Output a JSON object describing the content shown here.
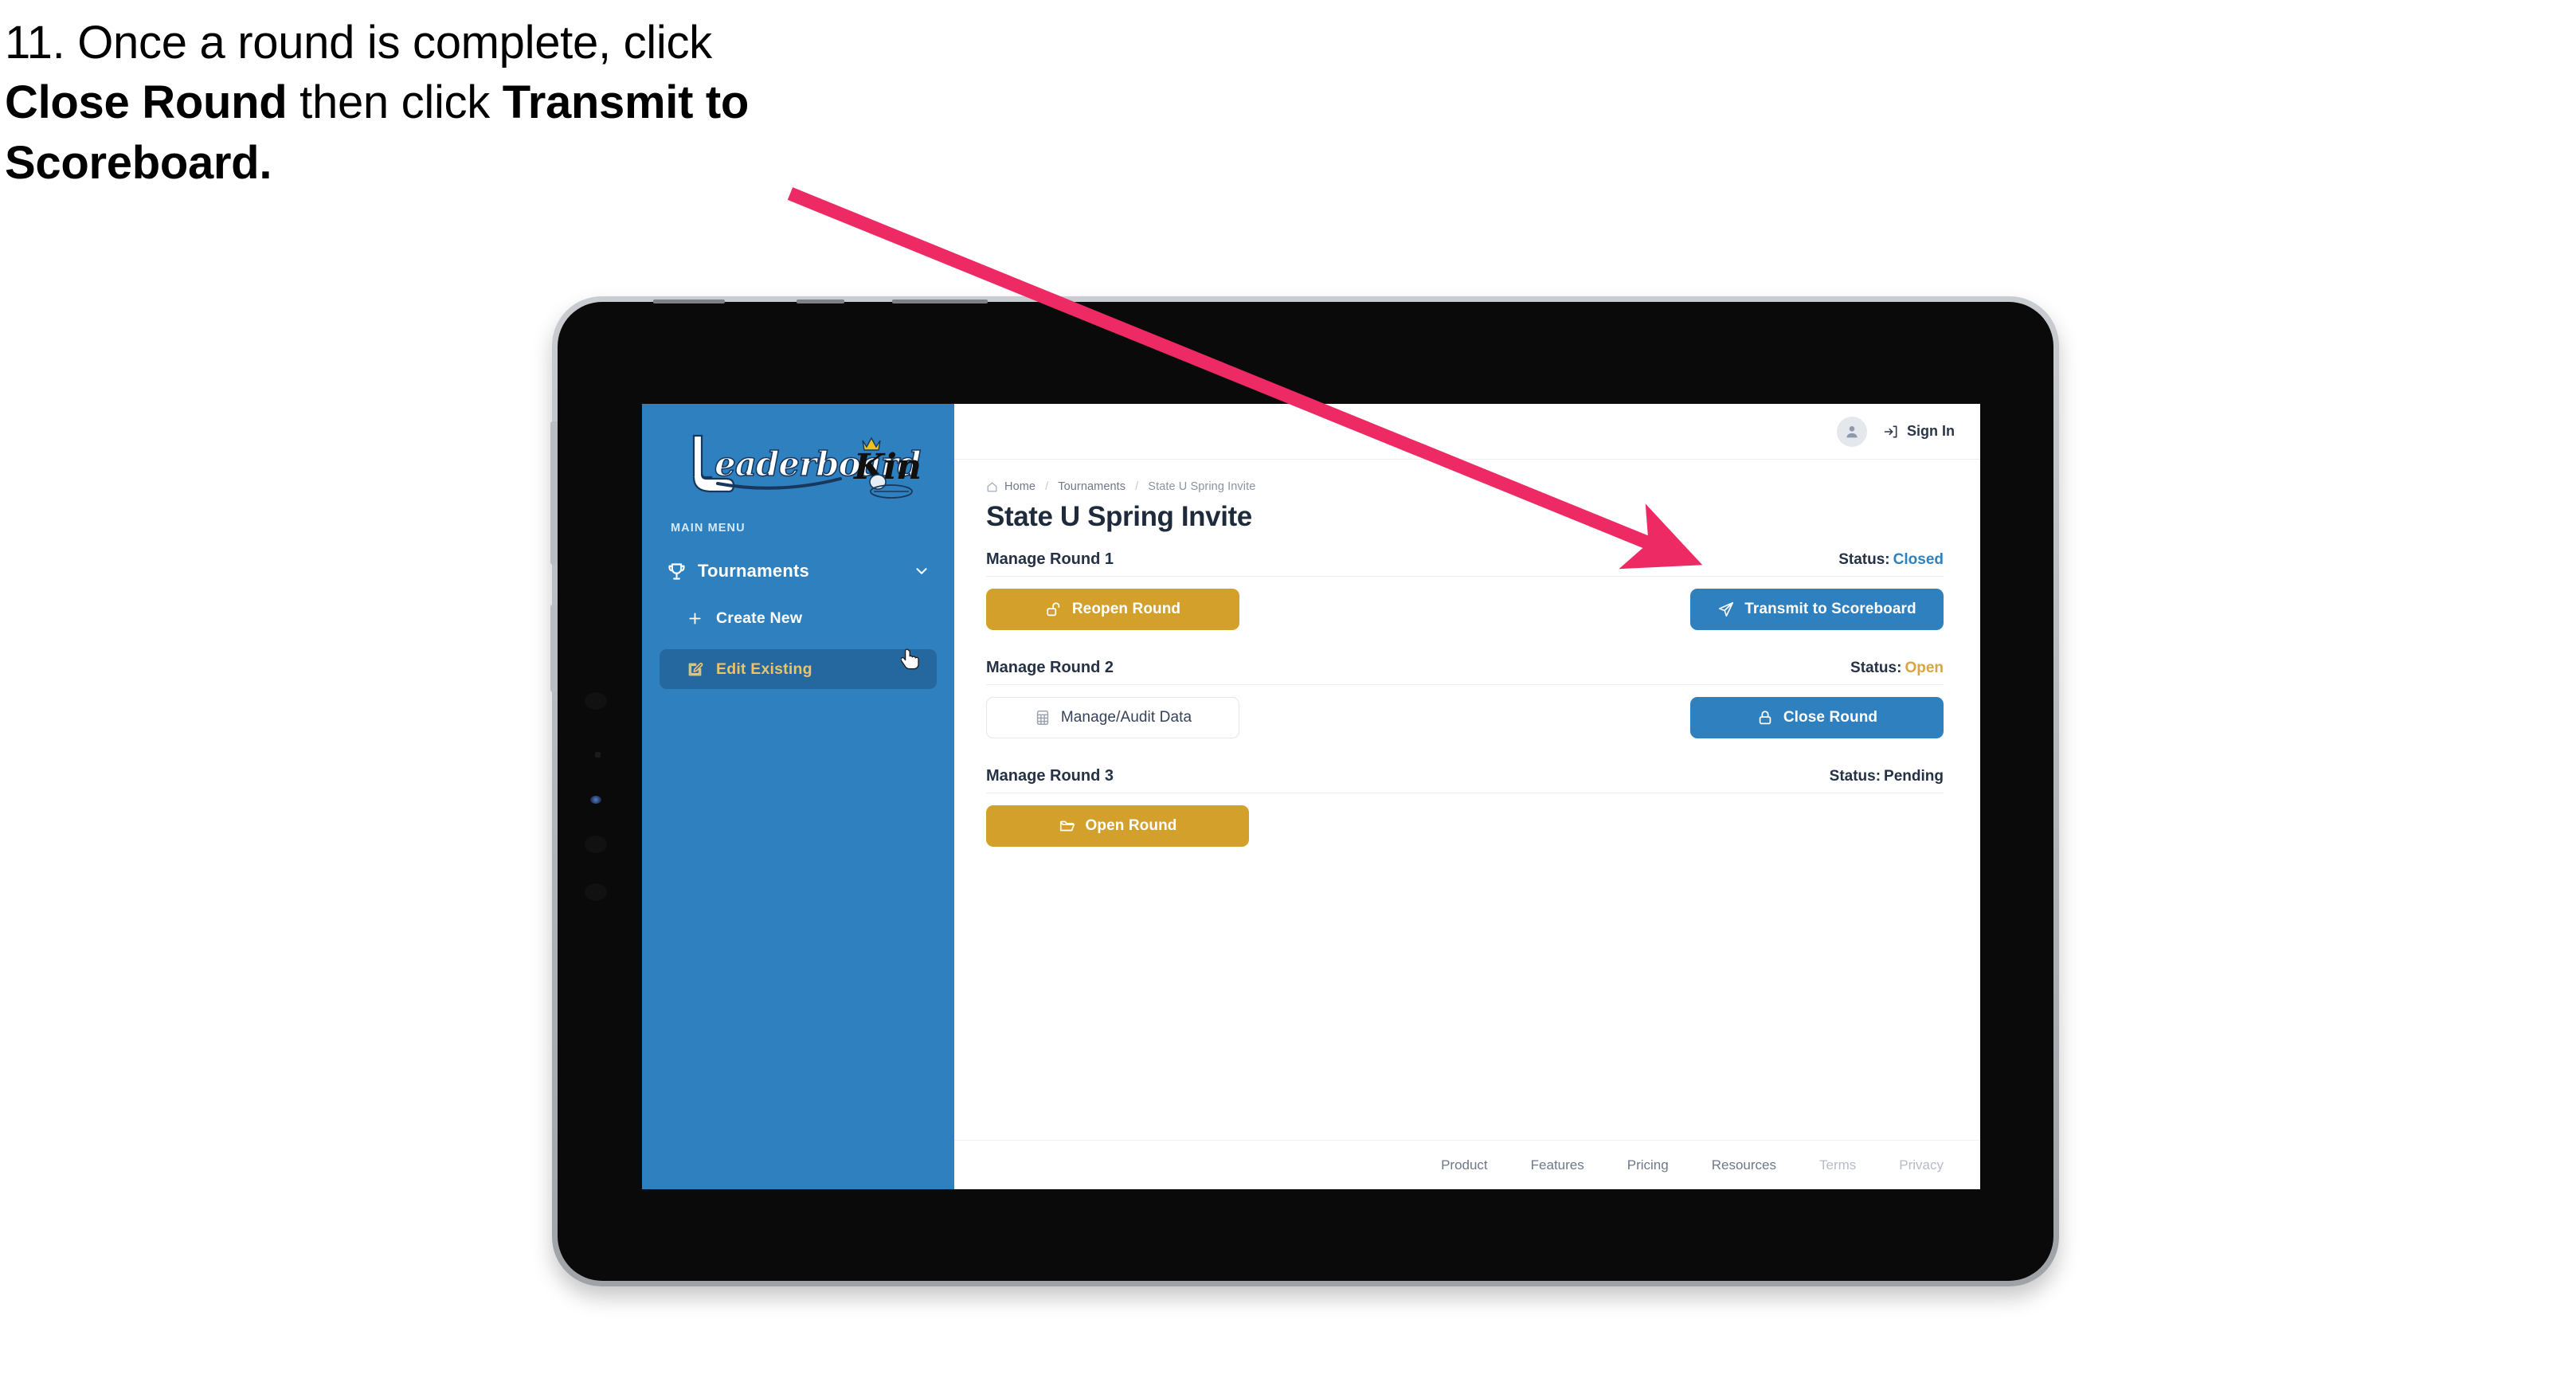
{
  "annotation": {
    "step_number": "11.",
    "text_part1": "11. Once a round is complete, click ",
    "bold1": "Close Round",
    "text_part2": " then click ",
    "bold2": "Transmit to Scoreboard.",
    "arrow_color": "#ed2a63"
  },
  "app": {
    "brand": {
      "word1": "Leaderboard",
      "word2": "King",
      "sidebar_color": "#2f80bf",
      "accent_gold": "#d4a02c",
      "accent_blue": "#2f80bf"
    },
    "sidebar": {
      "section_label": "MAIN MENU",
      "group": {
        "label": "Tournaments",
        "icon": "trophy-icon",
        "chevron": "chevron-down-icon",
        "expanded": true
      },
      "items": [
        {
          "label": "Create New",
          "icon": "plus-icon",
          "active": false
        },
        {
          "label": "Edit Existing",
          "icon": "pencil-square-icon",
          "active": true
        }
      ]
    },
    "topbar": {
      "avatar_icon": "user-avatar-icon",
      "signin_icon": "sign-in-icon",
      "signin_label": "Sign In"
    },
    "breadcrumb": {
      "home_icon": "home-icon",
      "items": [
        "Home",
        "Tournaments",
        "State U Spring Invite"
      ],
      "separator": "/"
    },
    "page_title": "State U Spring Invite",
    "rounds": [
      {
        "title": "Manage Round 1",
        "status_label": "Status:",
        "status_value": "Closed",
        "status_class": "st-closed",
        "left_button": {
          "label": "Reopen Round",
          "icon": "unlock-icon",
          "style": "gold"
        },
        "right_button": {
          "label": "Transmit to Scoreboard",
          "icon": "paper-plane-icon",
          "style": "blue"
        }
      },
      {
        "title": "Manage Round 2",
        "status_label": "Status:",
        "status_value": "Open",
        "status_class": "st-open",
        "left_button": {
          "label": "Manage/Audit Data",
          "icon": "table-grid-icon",
          "style": "ghost"
        },
        "right_button": {
          "label": "Close Round",
          "icon": "lock-icon",
          "style": "blue"
        }
      },
      {
        "title": "Manage Round 3",
        "status_label": "Status:",
        "status_value": "Pending",
        "status_class": "st-pending",
        "left_button": {
          "label": "Open Round",
          "icon": "open-folder-icon",
          "style": "gold"
        },
        "right_button": null
      }
    ],
    "footer": {
      "links": [
        {
          "label": "Product",
          "muted": false
        },
        {
          "label": "Features",
          "muted": false
        },
        {
          "label": "Pricing",
          "muted": false
        },
        {
          "label": "Resources",
          "muted": false
        },
        {
          "label": "Terms",
          "muted": true
        },
        {
          "label": "Privacy",
          "muted": true
        }
      ]
    }
  }
}
